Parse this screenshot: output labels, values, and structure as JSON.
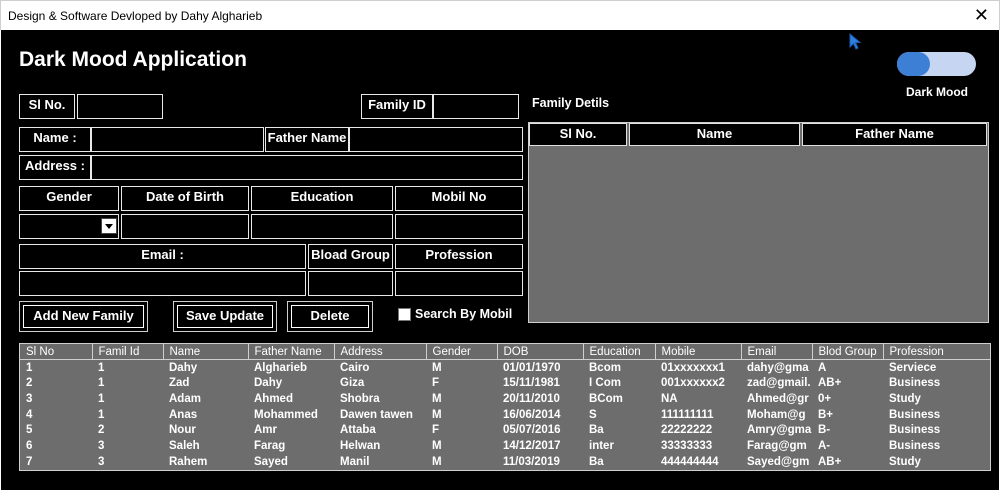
{
  "window": {
    "title": "Design & Software Devloped by Dahy Algharieb",
    "close": "✕"
  },
  "app": {
    "title": "Dark Mood Application",
    "dark_mode_label": "Dark Mood",
    "dark_mode_on": true
  },
  "form": {
    "sl_no": "Sl No.",
    "family_id": "Family ID",
    "name": "Name :",
    "father_name": "Father Name",
    "address": "Address :",
    "gender": "Gender",
    "dob": "Date of Birth",
    "education": "Education",
    "mobile": "Mobil No",
    "email": "Email :",
    "blood_group": "Bload Group",
    "profession": "Profession",
    "search_by_mobile": "Search By Mobil"
  },
  "buttons": {
    "add": "Add New Family",
    "save": "Save Update",
    "delete": "Delete"
  },
  "family_details": {
    "title": "Family Detils",
    "columns": [
      "Sl No.",
      "Name",
      "Father Name"
    ]
  },
  "grid": {
    "columns": [
      "Sl No",
      "Famil Id",
      "Name",
      "Father Name",
      "Address",
      "Gender",
      "DOB",
      "Education",
      "Mobile",
      "Email",
      "Blod Group",
      "Profession"
    ],
    "rows": [
      [
        "1",
        "1",
        "Dahy",
        "Algharieb",
        "Cairo",
        "M",
        "01/01/1970",
        "Bcom",
        "01xxxxxxx1",
        "dahy@gma",
        "A",
        "Serviece"
      ],
      [
        "2",
        "1",
        "Zad",
        "Dahy",
        "Giza",
        "F",
        "15/11/1981",
        "I Com",
        "001xxxxxx2",
        "zad@gmail.",
        "AB+",
        "Business"
      ],
      [
        "3",
        "1",
        "Adam",
        "Ahmed",
        "Shobra",
        "M",
        "20/11/2010",
        "BCom",
        "NA",
        "Ahmed@gr",
        "0+",
        "Study"
      ],
      [
        "4",
        "1",
        "Anas",
        "Mohammed",
        "Dawen tawen",
        "M",
        "16/06/2014",
        "S",
        "111111111",
        "Moham@g",
        "B+",
        "Business"
      ],
      [
        "5",
        "2",
        "Nour",
        "Amr",
        "Attaba",
        "F",
        "05/07/2016",
        "Ba",
        "22222222",
        "Amry@gma",
        "B-",
        "Business"
      ],
      [
        "6",
        "3",
        "Saleh",
        "Farag",
        "Helwan",
        "M",
        "14/12/2017",
        "inter",
        "33333333",
        "Farag@gm",
        "A-",
        "Business"
      ],
      [
        "7",
        "3",
        "Rahem",
        "Sayed",
        "Manil",
        "M",
        "11/03/2019",
        "Ba",
        "444444444",
        "Sayed@gm",
        "AB+",
        "Study"
      ]
    ]
  }
}
